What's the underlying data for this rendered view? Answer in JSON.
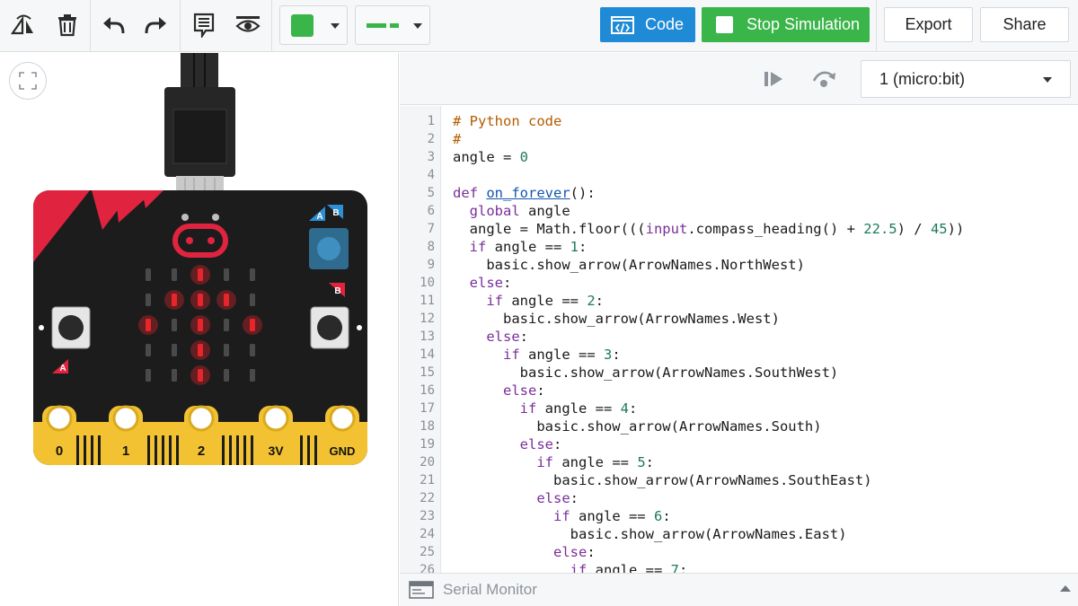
{
  "toolbar": {
    "code_label": "Code",
    "stop_label": "Stop Simulation",
    "export_label": "Export",
    "share_label": "Share",
    "color_value": "#3ab54a",
    "icons": [
      "rotate-icon",
      "delete-icon",
      "undo-icon",
      "redo-icon",
      "notes-icon",
      "visibility-icon",
      "color-swatch",
      "line-style"
    ]
  },
  "sim_controls": {
    "device_selected": "1 (micro:bit)",
    "icons": [
      "step-icon",
      "restart-icon"
    ]
  },
  "microbit": {
    "button_a": "A",
    "button_b": "B",
    "pins": [
      "0",
      "1",
      "2",
      "3V",
      "GND"
    ],
    "led_grid": [
      [
        0,
        0,
        1,
        0,
        0
      ],
      [
        0,
        1,
        1,
        1,
        0
      ],
      [
        1,
        0,
        1,
        0,
        1
      ],
      [
        0,
        0,
        1,
        0,
        0
      ],
      [
        0,
        0,
        1,
        0,
        0
      ]
    ],
    "led_on_color": "#e8252b",
    "board_color": "#1c1c1c",
    "accent_color": "#e0243f",
    "pin_color": "#f2c232"
  },
  "code": {
    "line_numbers": [
      "1",
      "2",
      "3",
      "4",
      "5",
      "6",
      "7",
      "8",
      "9",
      "10",
      "11",
      "12",
      "13",
      "14",
      "15",
      "16",
      "17",
      "18",
      "19",
      "20",
      "21",
      "22",
      "23",
      "24",
      "25",
      "26"
    ]
  },
  "serial": {
    "label": "Serial Monitor"
  }
}
